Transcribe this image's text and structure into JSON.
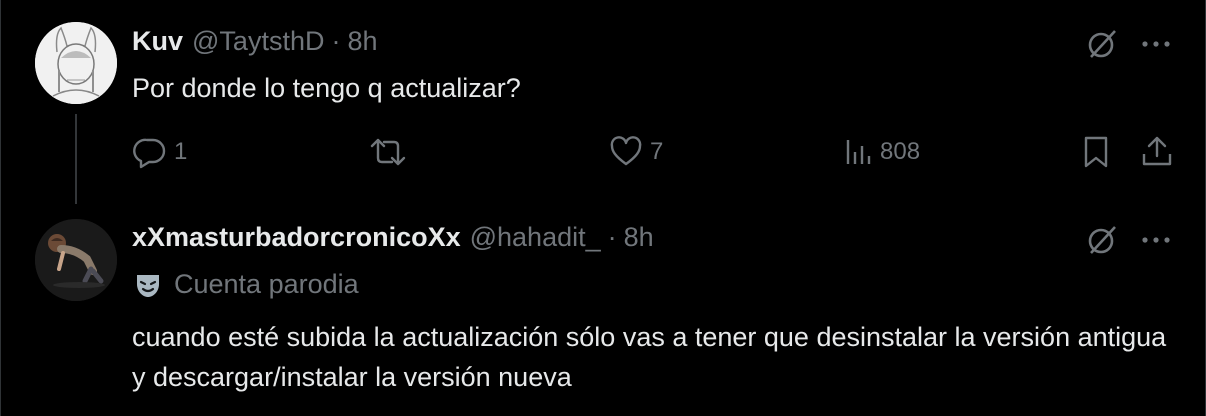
{
  "tweets": [
    {
      "name": "Kuv",
      "handle": "@TaytsthD",
      "separator": "·",
      "time": "8h",
      "text": "Por donde lo tengo q actualizar?",
      "stats": {
        "replies": "1",
        "likes": "7",
        "views": "808"
      }
    },
    {
      "name": "xXmasturbadorcronicoXx",
      "handle": "@hahadit_",
      "separator": "·",
      "time": "8h",
      "badge": "Cuenta parodia",
      "text": "cuando esté subida la actualización sólo vas a tener que desinstalar la versión antigua y descargar/instalar la versión nueva"
    }
  ],
  "icons": {
    "grok": "grok-icon",
    "more": "more-icon",
    "reply": "reply-icon",
    "repost": "repost-icon",
    "like": "heart-icon",
    "views": "views-icon",
    "bookmark": "bookmark-icon",
    "share": "share-icon",
    "parody": "parody-mask-icon"
  },
  "colors": {
    "background": "#000000",
    "text_primary": "#e7e9ea",
    "text_secondary": "#71767b",
    "thread_line": "#333639"
  }
}
